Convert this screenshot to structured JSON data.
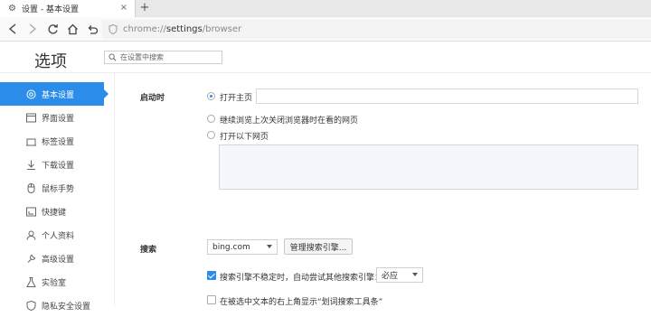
{
  "tab": {
    "title": "设置 - 基本设置",
    "icon": "gear-icon",
    "close_glyph": "×",
    "new_tab_glyph": "+"
  },
  "address_bar": {
    "scheme": "chrome://",
    "host": "settings",
    "path": "/browser"
  },
  "header": {
    "title": "选项",
    "search_placeholder": "在设置中搜索"
  },
  "sidebar": {
    "items": [
      {
        "label": "基本设置",
        "icon": "settings-circle-icon",
        "active": true
      },
      {
        "label": "界面设置",
        "icon": "window-icon",
        "active": false
      },
      {
        "label": "标签设置",
        "icon": "tab-icon",
        "active": false
      },
      {
        "label": "下载设置",
        "icon": "download-icon",
        "active": false
      },
      {
        "label": "鼠标手势",
        "icon": "mouse-icon",
        "active": false
      },
      {
        "label": "快捷键",
        "icon": "keyboard-icon",
        "active": false
      },
      {
        "label": "个人资料",
        "icon": "person-icon",
        "active": false
      },
      {
        "label": "高级设置",
        "icon": "wrench-icon",
        "active": false
      },
      {
        "label": "实验室",
        "icon": "flask-icon",
        "active": false
      },
      {
        "label": "隐私安全设置",
        "icon": "shield-icon",
        "active": false
      }
    ]
  },
  "startup": {
    "label": "启动时",
    "options": [
      {
        "label": "打开主页",
        "selected": true
      },
      {
        "label": "继续浏览上次关闭浏览器时在看的网页",
        "selected": false
      },
      {
        "label": "打开以下网页",
        "selected": false
      }
    ],
    "homepage_value": ""
  },
  "search": {
    "label": "搜索",
    "engine": "bing.com",
    "manage_button": "管理搜索引擎...",
    "fallback_checkbox": {
      "label": "搜索引擎不稳定时，自动尝试其他搜索引擎：",
      "checked": true
    },
    "fallback_mode": "必应",
    "toolbar_checkbox": {
      "label": "在被选中文本的右上角显示“划词搜索工具条”",
      "checked": false
    }
  },
  "colors": {
    "accent": "#2b8cea"
  }
}
